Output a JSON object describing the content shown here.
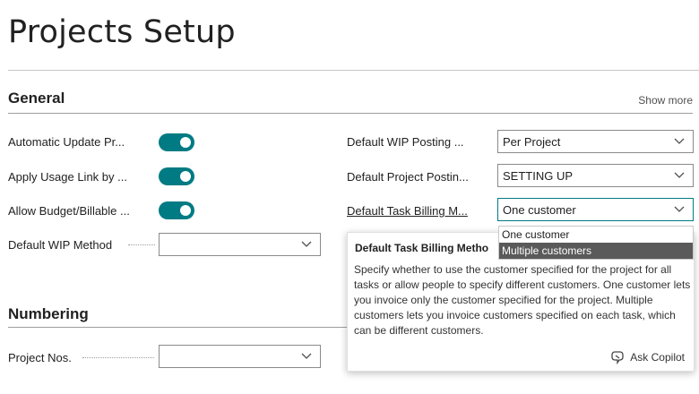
{
  "page": {
    "title": "Projects Setup"
  },
  "general": {
    "heading": "General",
    "show_more": "Show more",
    "left_fields": [
      {
        "label": "Automatic Update Pr...",
        "type": "toggle",
        "value": true
      },
      {
        "label": "Apply Usage Link by ...",
        "type": "toggle",
        "value": true
      },
      {
        "label": "Allow Budget/Billable ...",
        "type": "toggle",
        "value": true
      },
      {
        "label": "Default WIP Method",
        "type": "select",
        "value": ""
      }
    ],
    "right_fields": [
      {
        "label": "Default WIP Posting ...",
        "value": "Per Project"
      },
      {
        "label": "Default Project Postin...",
        "value": "SETTING UP"
      },
      {
        "label": "Default Task Billing M...",
        "value": "One customer"
      }
    ]
  },
  "numbering": {
    "heading": "Numbering",
    "fields": [
      {
        "label": "Project Nos.",
        "value": ""
      }
    ]
  },
  "dropdown": {
    "options": [
      "One customer",
      "Multiple customers"
    ],
    "highlighted": "Multiple customers"
  },
  "tooltip": {
    "title": "Default Task Billing Metho",
    "body": "Specify whether to use the customer specified for the project for all tasks or allow people to specify different customers. One customer lets you invoice only the customer specified for the project. Multiple customers lets you invoice customers specified on each task, which can be different customers.",
    "ask_copilot": "Ask Copilot"
  },
  "colors": {
    "accent": "#007b83",
    "highlight": "#5a5a5a"
  }
}
